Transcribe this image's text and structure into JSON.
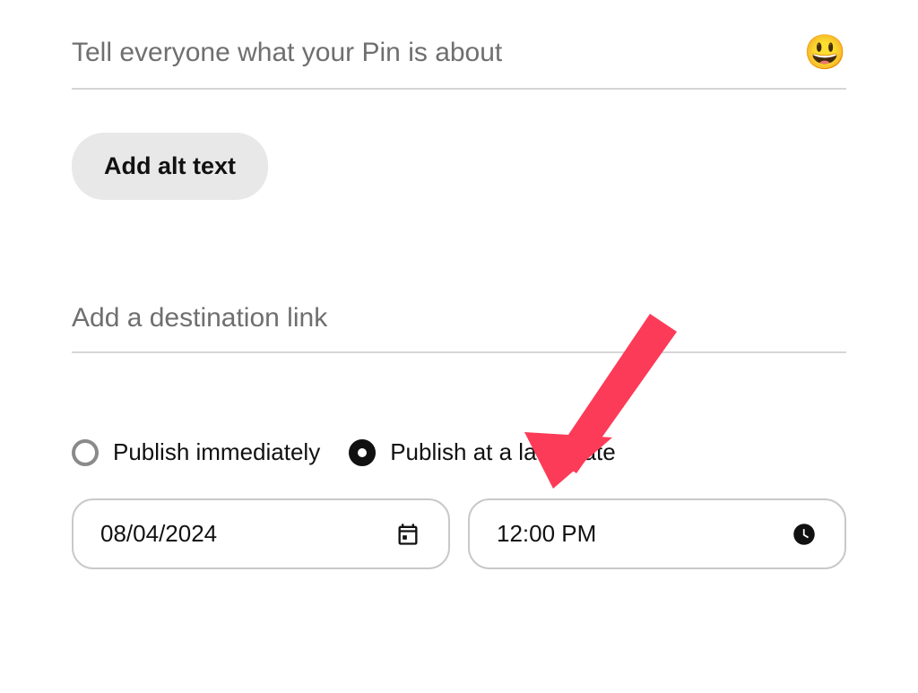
{
  "description": {
    "placeholder": "Tell everyone what your Pin is about",
    "value": "",
    "emoji": "😃"
  },
  "alt_text_button": "Add alt text",
  "destination_link": {
    "placeholder": "Add a destination link",
    "value": ""
  },
  "publish_options": {
    "immediate_label": "Publish immediately",
    "later_label": "Publish at a later date",
    "selected": "later"
  },
  "schedule": {
    "date": "08/04/2024",
    "time": "12:00 PM"
  },
  "colors": {
    "arrow": "#fc3b58"
  }
}
